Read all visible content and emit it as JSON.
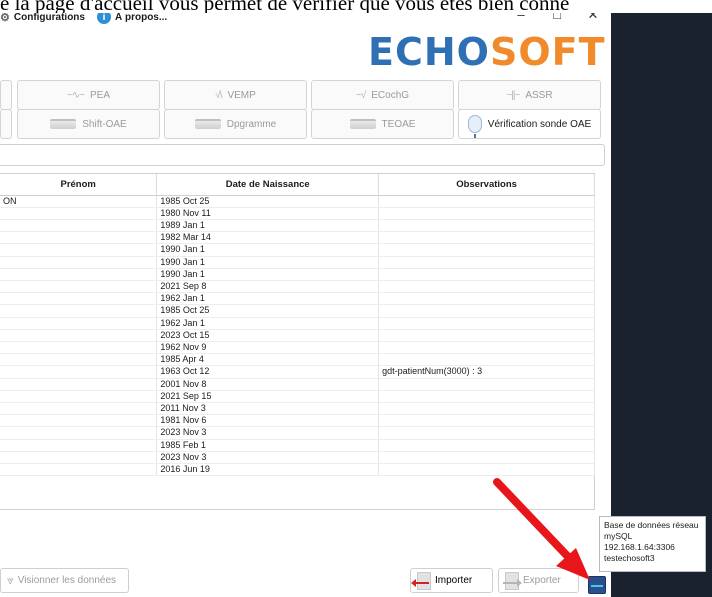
{
  "doc_text": "e la page d'accueil vous permet de vérifier que vous êtes bien conne",
  "menu": [
    {
      "label": "Configurations",
      "icon": "gear-icon"
    },
    {
      "label": "À propos...",
      "icon": "info-icon"
    }
  ],
  "window_controls": {
    "minimize": "–",
    "maximize": "□",
    "close": "✕"
  },
  "logo": {
    "part1": "ECHO",
    "part2": "SOFT",
    "brand_blue": "#2f6fb3",
    "brand_orange": "#f08a2a"
  },
  "tabs_row1": [
    {
      "label": "PEA",
      "icon": "waveform-icon"
    },
    {
      "label": "VEMP",
      "icon": "waveform-icon"
    },
    {
      "label": "ECochG",
      "icon": "waveform-icon"
    },
    {
      "label": "ASSR",
      "icon": "waveform-icon"
    }
  ],
  "tabs_row2": [
    {
      "label": "Shift-OAE",
      "icon": "chart-icon"
    },
    {
      "label": "Dpgramme",
      "icon": "chart-icon"
    },
    {
      "label": "TEOAE",
      "icon": "chart-icon"
    },
    {
      "label": "Vérification sonde OAE",
      "icon": "microphone-icon"
    }
  ],
  "table": {
    "headers": [
      "Prénom",
      "Date de Naissance",
      "Observations"
    ],
    "rows": [
      [
        "ON",
        "1985 Oct 25",
        ""
      ],
      [
        "",
        "1980 Nov 11",
        ""
      ],
      [
        "",
        "1989 Jan 1",
        ""
      ],
      [
        "",
        "1982 Mar 14",
        ""
      ],
      [
        "",
        "1990 Jan 1",
        ""
      ],
      [
        "",
        "1990 Jan 1",
        ""
      ],
      [
        "",
        "1990 Jan 1",
        ""
      ],
      [
        "",
        "2021 Sep 8",
        ""
      ],
      [
        "",
        "1962 Jan 1",
        ""
      ],
      [
        "",
        "1985 Oct 25",
        ""
      ],
      [
        "",
        "1962 Jan 1",
        ""
      ],
      [
        "",
        "2023 Oct 15",
        ""
      ],
      [
        "",
        "1962 Nov 9",
        ""
      ],
      [
        "",
        "1985 Apr 4",
        ""
      ],
      [
        "",
        "1963 Oct 12",
        "gdt-patientNum(3000) : 3"
      ],
      [
        "",
        "2001 Nov 8",
        ""
      ],
      [
        "",
        "2021 Sep 15",
        ""
      ],
      [
        "",
        "2011 Nov 3",
        ""
      ],
      [
        "",
        "1981 Nov 6",
        ""
      ],
      [
        "",
        "2023 Nov 3",
        ""
      ],
      [
        "",
        "1985 Feb 1",
        ""
      ],
      [
        "",
        "2023 Nov 3",
        ""
      ],
      [
        "",
        "2016 Jun 19",
        ""
      ]
    ]
  },
  "buttons": {
    "view": "Visionner les données",
    "import": "Importer",
    "export": "Exporter"
  },
  "tooltip": {
    "line1": "Base de données réseau",
    "line2": "mySQL",
    "line3": "192.168.1.64:3306",
    "line4": "testechosoft3"
  },
  "annotation_arrow_color": "#e8161b"
}
